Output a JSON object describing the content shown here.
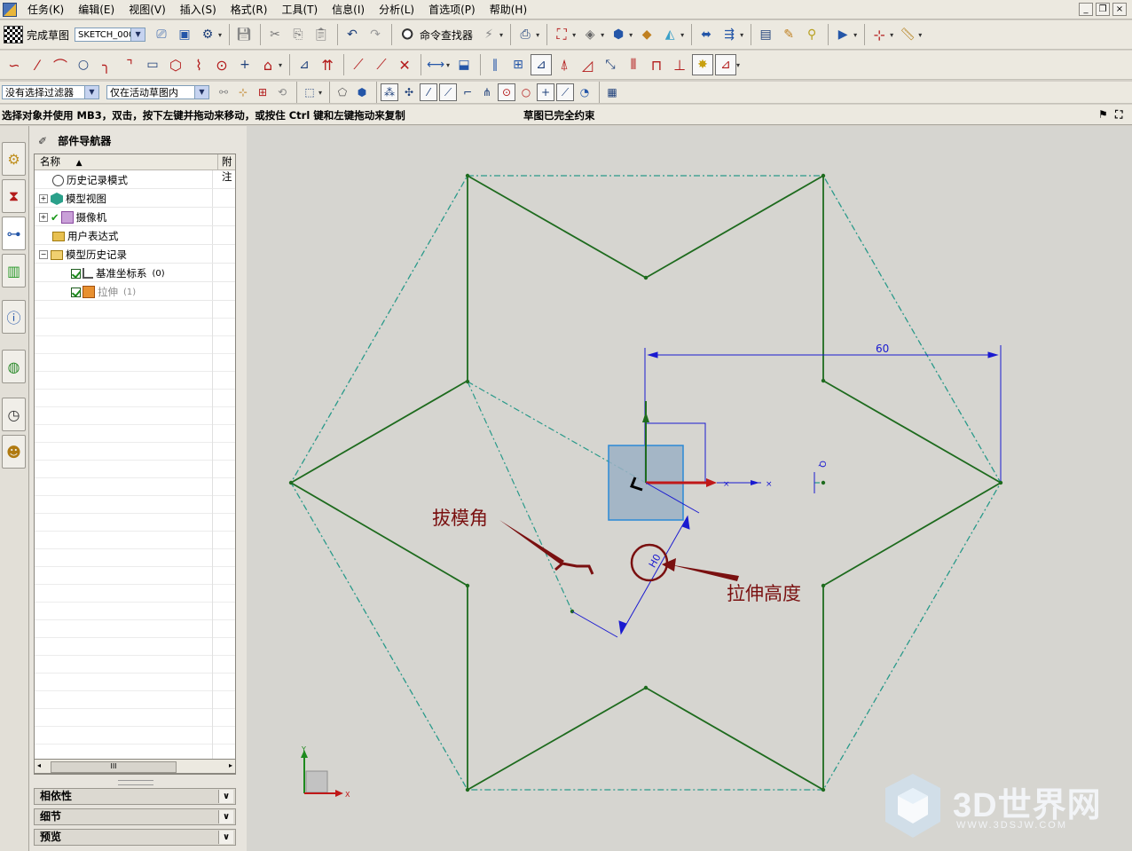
{
  "menubar": {
    "items": [
      "任务(K)",
      "编辑(E)",
      "视图(V)",
      "插入(S)",
      "格式(R)",
      "工具(T)",
      "信息(I)",
      "分析(L)",
      "首选项(P)",
      "帮助(H)"
    ]
  },
  "toolbar": {
    "finish_sketch_label": "完成草图",
    "sketch_name": "SKETCH_000",
    "command_finder_label": "命令查找器"
  },
  "selection_bar": {
    "filter_value": "没有选择过滤器",
    "scope_value": "仅在活动草图内"
  },
  "statusbar": {
    "prompt": "选择对象并使用 MB3，双击，按下左键并拖动来移动，或按住 Ctrl 键和左键拖动来复制",
    "status": "草图已完全约束"
  },
  "navigator": {
    "title": "部件导航器",
    "columns": {
      "name": "名称",
      "attach": "附注"
    },
    "items": [
      {
        "label": "历史记录模式",
        "count": ""
      },
      {
        "label": "模型视图",
        "count": ""
      },
      {
        "label": "摄像机",
        "count": ""
      },
      {
        "label": "用户表达式",
        "count": ""
      },
      {
        "label": "模型历史记录",
        "count": ""
      },
      {
        "label": "基准坐标系",
        "count": "(0)"
      },
      {
        "label": "拉伸",
        "count": "(1)"
      }
    ],
    "panels": [
      "相依性",
      "细节",
      "预览"
    ]
  },
  "canvas": {
    "dimension_60": "60",
    "dimension_height": "H0",
    "axis_label_q": "Q",
    "annotation_draft_angle": "拔模角",
    "annotation_extrude_height": "拉伸高度",
    "triad_y": "Y",
    "triad_x": "X",
    "colors": {
      "background": "#d6d5d0",
      "profile": "#1e6b1e",
      "reference": "#2a9a8a",
      "dimension": "#1a1ad0",
      "annotation": "#7a1010",
      "handle_fill": "#9bb0c4",
      "handle_border": "#2b8ad6"
    }
  },
  "watermark": {
    "text": "3D世界网",
    "url": "WWW.3DSJW.COM"
  }
}
